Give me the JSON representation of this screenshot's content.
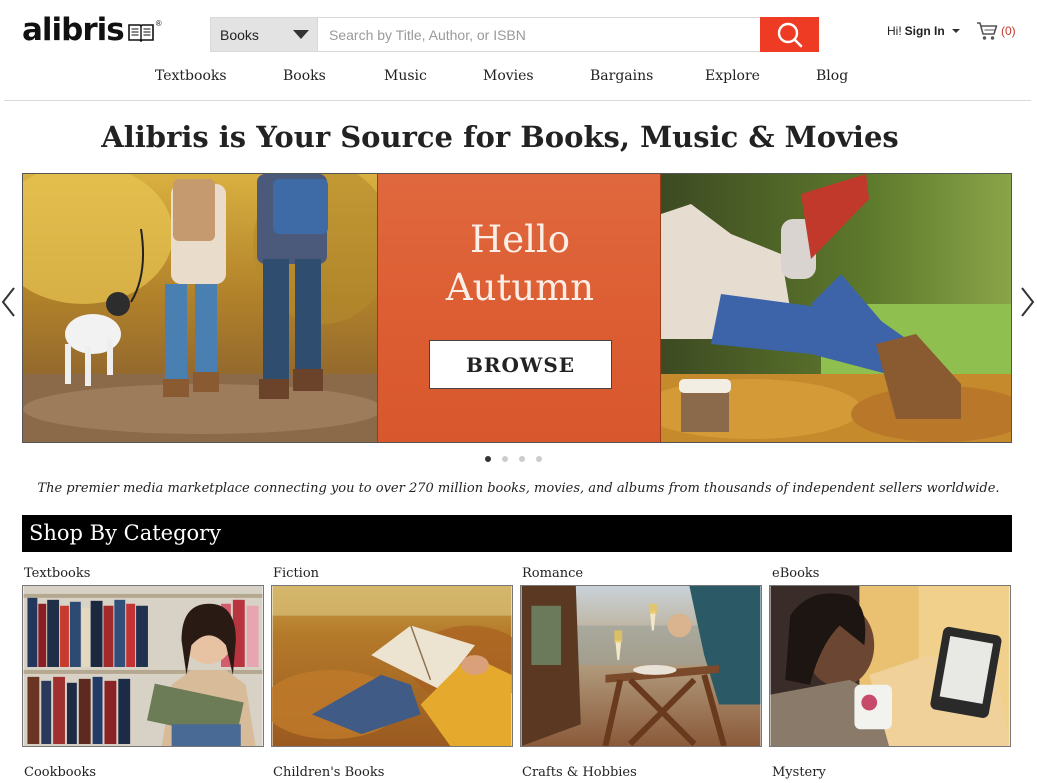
{
  "header": {
    "logo_text": "alibris",
    "logo_mark": "®",
    "search_category": "Books",
    "search_placeholder": "Search by Title, Author, or ISBN",
    "search_icon": "search-icon",
    "greeting": "Hi!",
    "sign_in": "Sign In",
    "cart_icon": "cart-icon",
    "cart_count": "(0)"
  },
  "nav": [
    "Textbooks",
    "Books",
    "Music",
    "Movies",
    "Bargains",
    "Explore",
    "Blog"
  ],
  "headline": "Alibris is Your Source for Books, Music & Movies",
  "hero": {
    "promo_text": "Hello\nAutumn",
    "browse_label": "BROWSE",
    "slide_count": 4,
    "active_slide": 1
  },
  "tagline": "The premier media marketplace connecting you to over 270 million books, movies, and albums from thousands of independent sellers worldwide.",
  "shop_by_category": {
    "title": "Shop By Category",
    "row1": [
      "Textbooks",
      "Fiction",
      "Romance",
      "eBooks"
    ],
    "row2": [
      "Cookbooks",
      "Children's Books",
      "Crafts & Hobbies",
      "Mystery"
    ]
  },
  "colors": {
    "accent": "#ee3b24",
    "promo": "#dd5e33",
    "category_bar": "#000000"
  }
}
